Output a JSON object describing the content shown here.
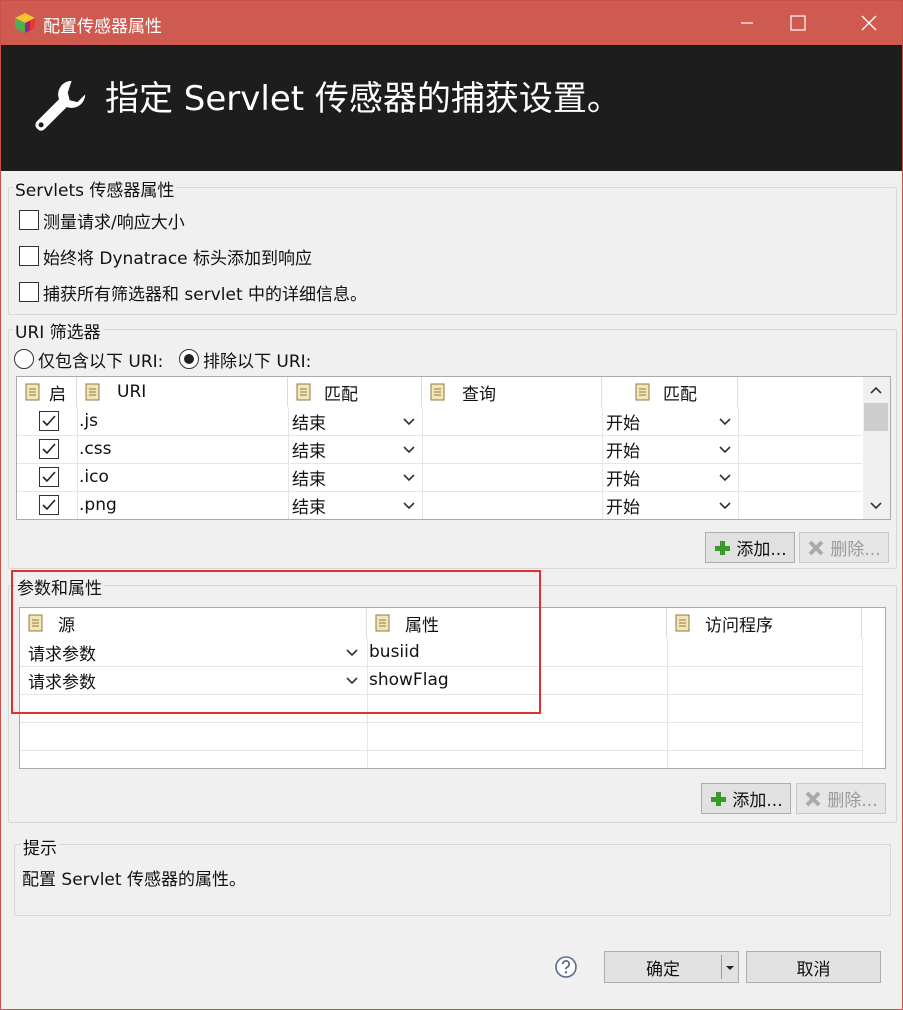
{
  "window": {
    "title": "配置传感器属性"
  },
  "banner": {
    "heading": "指定 Servlet 传感器的捕获设置。"
  },
  "servlet_props": {
    "title": "Servlets 传感器属性",
    "options": [
      {
        "label": "测量请求/响应大小",
        "checked": false
      },
      {
        "label": "始终将 Dynatrace 标头添加到响应",
        "checked": false
      },
      {
        "label": "捕获所有筛选器和 servlet 中的详细信息。",
        "checked": false
      }
    ]
  },
  "uri_filter": {
    "title": "URI 筛选器",
    "include_label": "仅包含以下 URI:",
    "exclude_label": "排除以下 URI:",
    "selected": "exclude",
    "columns": [
      "启",
      "URI",
      "匹配",
      "查询",
      "匹配"
    ],
    "rows": [
      {
        "enabled": true,
        "uri": ".js",
        "match": "结束",
        "query": "",
        "qmatch": "开始"
      },
      {
        "enabled": true,
        "uri": ".css",
        "match": "结束",
        "query": "",
        "qmatch": "开始"
      },
      {
        "enabled": true,
        "uri": ".ico",
        "match": "结束",
        "query": "",
        "qmatch": "开始"
      },
      {
        "enabled": true,
        "uri": ".png",
        "match": "结束",
        "query": "",
        "qmatch": "开始"
      }
    ],
    "add_label": "添加...",
    "remove_label": "删除..."
  },
  "params": {
    "title": "参数和属性",
    "columns": [
      "源",
      "属性",
      "访问程序"
    ],
    "rows": [
      {
        "source": "请求参数",
        "attr": "busiid",
        "accessor": ""
      },
      {
        "source": "请求参数",
        "attr": "showFlag",
        "accessor": ""
      }
    ],
    "add_label": "添加...",
    "remove_label": "删除..."
  },
  "hint": {
    "title": "提示",
    "text": "配置 Servlet 传感器的属性。"
  },
  "footer": {
    "ok_label": "确定",
    "cancel_label": "取消"
  },
  "colors": {
    "titlebar": "#cf5b50",
    "banner": "#1d1d1d",
    "highlight": "#e03030",
    "add_icon": "#3c9a2c"
  }
}
